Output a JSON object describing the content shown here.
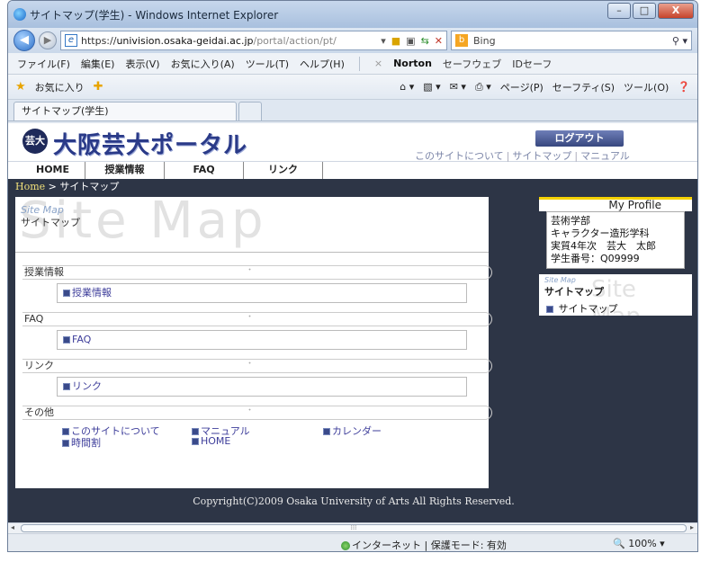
{
  "window": {
    "title": "サイトマップ(学生) - Windows Internet Explorer",
    "controls": {
      "minimize": "–",
      "maximize": "□",
      "close": "X"
    }
  },
  "address": {
    "url_scheme": "https://",
    "url_host": "univision.osaka-geidai.ac.jp",
    "url_path": "/portal/action/pt/",
    "search_engine": "Bing"
  },
  "menubar": {
    "items": [
      "ファイル(F)",
      "編集(E)",
      "表示(V)",
      "お気に入り(A)",
      "ツール(T)",
      "ヘルプ(H)"
    ],
    "norton": "Norton",
    "safeweb": "セーフウェブ",
    "idsafe": "IDセーフ"
  },
  "favbar": {
    "favorites": "お気に入り",
    "page": "ページ(P)",
    "safety": "セーフティ(S)",
    "tools": "ツール(O)"
  },
  "tab": {
    "label": "サイトマップ(学生)"
  },
  "site": {
    "logo_mark": "芸大",
    "logo_text": "大阪芸大ポータル",
    "logout": "ログアウト",
    "header_links": [
      "このサイトについて",
      "サイトマップ",
      "マニュアル"
    ],
    "nav": [
      "HOME",
      "授業情報",
      "FAQ",
      "リンク"
    ],
    "breadcrumb_home": "Home",
    "breadcrumb_current": "> サイトマップ"
  },
  "sitemap": {
    "bg_text": "Site Map",
    "title_en": "Site Map",
    "title_ja": "サイトマップ",
    "sections": [
      {
        "heading": "授業情報",
        "link": "授業情報"
      },
      {
        "heading": "FAQ",
        "link": "FAQ"
      },
      {
        "heading": "リンク",
        "link": "リンク"
      }
    ],
    "other_heading": "その他",
    "other_links": [
      "このサイトについて",
      "マニュアル",
      "カレンダー",
      "時間割",
      "HOME"
    ]
  },
  "profile": {
    "heading": "My Profile",
    "faculty": "芸術学部",
    "department": "キャラクター造形学科",
    "year_name": "実質4年次　芸大　太郎",
    "student_no": "学生番号：Q09999"
  },
  "side_sitemap": {
    "en": "Site Map",
    "ja": "サイトマップ",
    "bg": "Site Map",
    "link": "サイトマップ"
  },
  "copyright": "Copyright(C)2009 Osaka University of Arts All Rights Reserved.",
  "statusbar": {
    "zone": "インターネット | 保護モード: 有効",
    "zoom": "100%"
  }
}
